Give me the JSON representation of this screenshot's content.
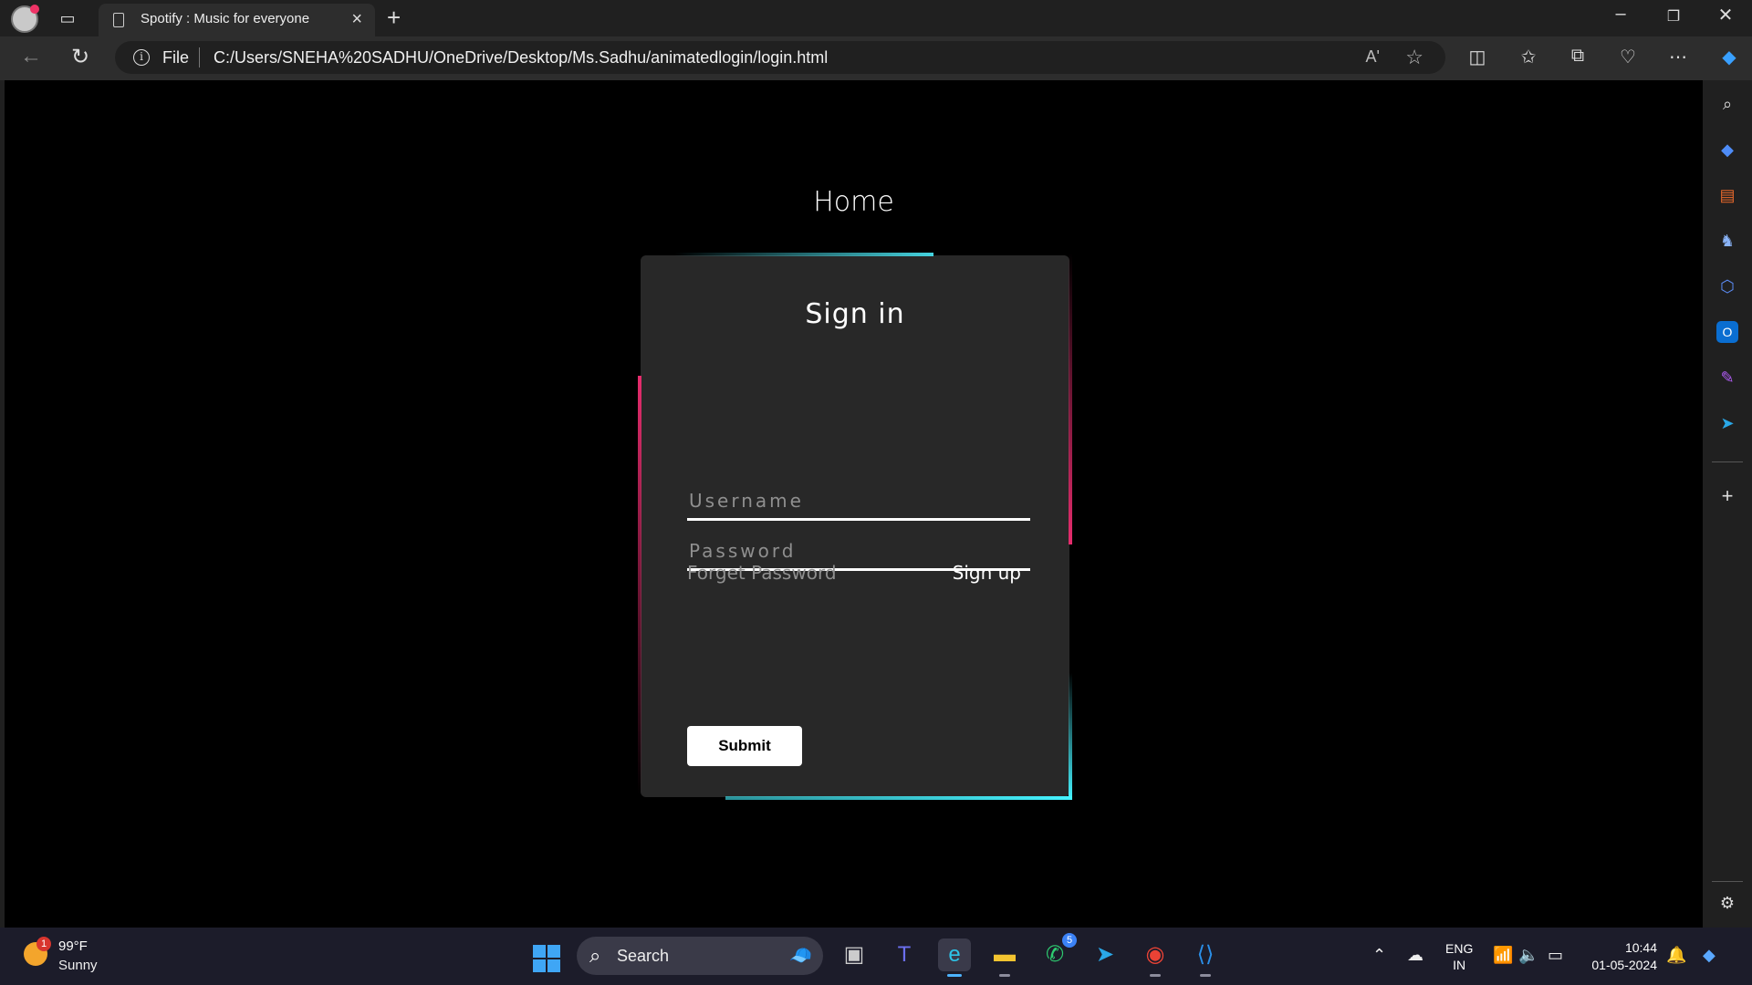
{
  "browser": {
    "tab_title": "Spotify : Music for everyone",
    "scheme_label": "File",
    "url": "C:/Users/SNEHA%20SADHU/OneDrive/Desktop/Ms.Sadhu/animatedlogin/login.html",
    "read_aloud_label": "Aʹ"
  },
  "page": {
    "nav_title": "Home",
    "form": {
      "heading": "Sign in",
      "username_placeholder": "Username",
      "password_placeholder": "Password",
      "forget_label": "Forget Password",
      "signup_label": "Sign up",
      "submit_label": "Submit"
    },
    "accent_colors": {
      "cyan": "#45f3ff",
      "pink": "#e62c6d"
    }
  },
  "taskbar": {
    "weather": {
      "temp": "99°F",
      "condition": "Sunny",
      "badge": "1"
    },
    "search_label": "Search",
    "whatsapp_badge": "5",
    "language": {
      "line1": "ENG",
      "line2": "IN"
    },
    "clock": {
      "time": "10:44",
      "date": "01-05-2024"
    }
  }
}
